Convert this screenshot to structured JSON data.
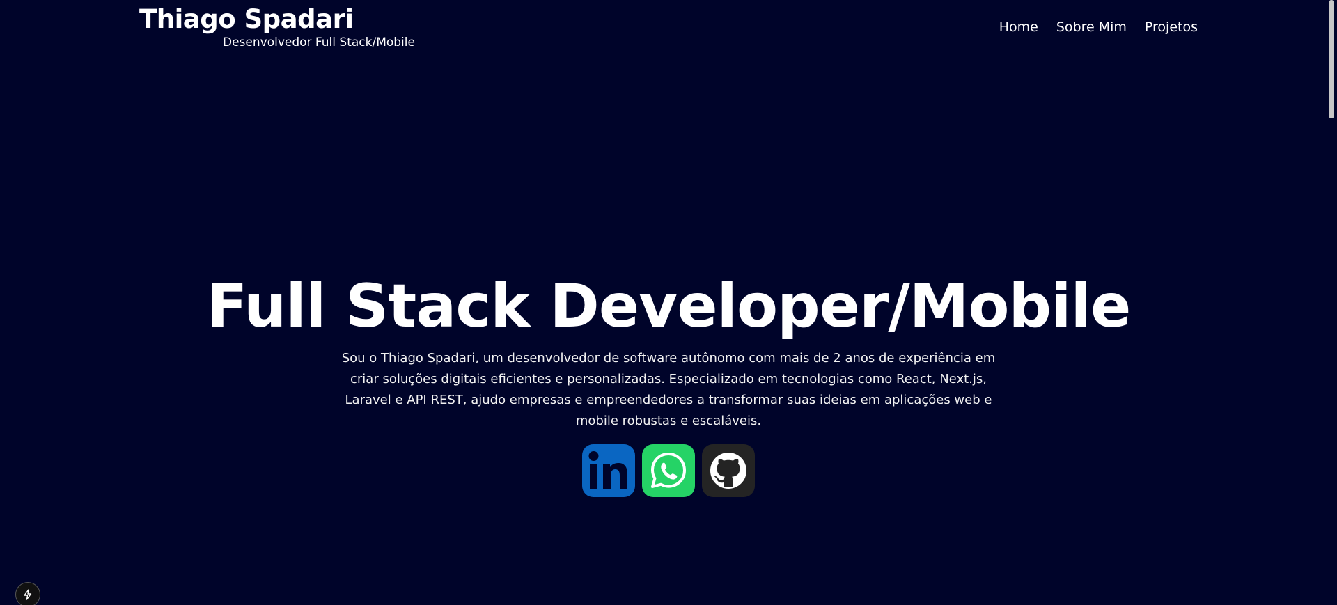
{
  "header": {
    "brand_name": "Thiago Spadari",
    "brand_role": "Desenvolvedor Full Stack/Mobile",
    "nav": [
      "Home",
      "Sobre Mim",
      "Projetos"
    ]
  },
  "hero": {
    "title": "Full Stack Developer/Mobile",
    "description": "Sou o Thiago Spadari, um desenvolvedor de software autônomo com mais de 2 anos de experiência em criar soluções digitais eficientes e personalizadas. Especializado em tecnologias como React, Next.js, Laravel e API REST, ajudo empresas e empreendedores a transformar suas ideias em aplicações web e mobile robustas e escaláveis."
  },
  "socials": [
    {
      "icon": "linkedin-icon",
      "color": "#0a66c2"
    },
    {
      "icon": "whatsapp-icon",
      "color": "#25d366"
    },
    {
      "icon": "github-icon",
      "color": "#242424"
    }
  ],
  "colors": {
    "background": "#00042a",
    "text": "#ffffff"
  }
}
